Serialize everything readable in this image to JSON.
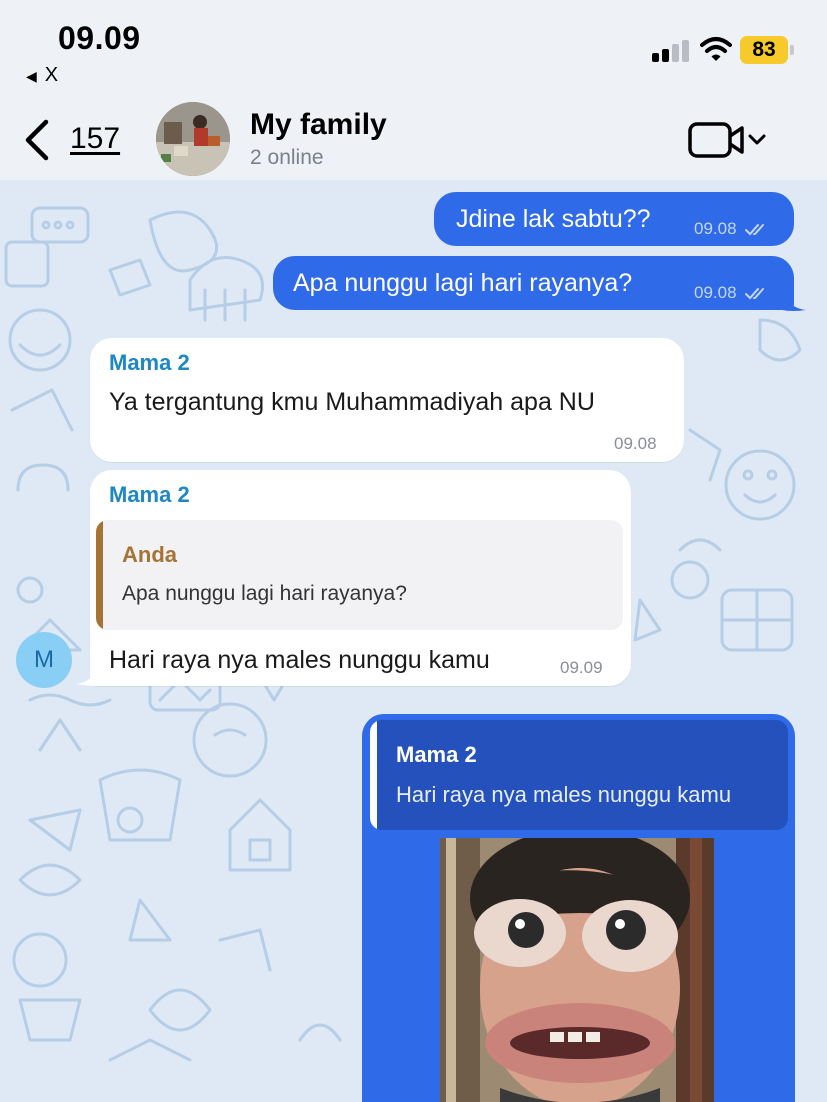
{
  "status_bar": {
    "time": "09.09",
    "back_app": "X",
    "battery": "83"
  },
  "header": {
    "back_count": "157",
    "title": "My family",
    "subtitle": "2 online"
  },
  "messages": [
    {
      "direction": "out",
      "text": "Jdine lak sabtu??",
      "time": "09.08"
    },
    {
      "direction": "out",
      "text": "Apa nunggu lagi hari rayanya?",
      "time": "09.08"
    },
    {
      "direction": "in",
      "sender": "Mama 2",
      "text": "Ya tergantung kmu Muhammadiyah apa NU",
      "time": "09.08"
    },
    {
      "direction": "in",
      "sender": "Mama 2",
      "reply_to": {
        "name": "Anda",
        "text": "Apa nunggu lagi hari rayanya?"
      },
      "text": "Hari raya nya males nunggu kamu",
      "time": "09.09",
      "avatar_letter": "M"
    },
    {
      "direction": "out",
      "reply_to": {
        "name": "Mama 2",
        "text": "Hari raya nya males nunggu kamu"
      },
      "media": "photo"
    }
  ],
  "colors": {
    "outgoing_bubble": "#2f6ae8",
    "incoming_bubble": "#ffffff",
    "sender_name": "#1d88c4",
    "quote_accent": "#a57434",
    "battery": "#f6ca2b",
    "chat_background": "#dfe9f5"
  },
  "icons": [
    "back-chevron-icon",
    "video-call-icon",
    "chevron-down-icon",
    "cellular-signal-icon",
    "wifi-icon",
    "battery-icon",
    "double-check-icon"
  ]
}
